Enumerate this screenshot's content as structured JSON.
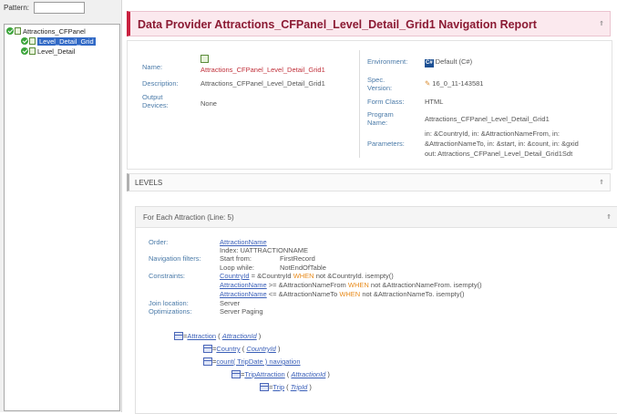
{
  "sidebar": {
    "pattern_label": "Pattern:",
    "pattern_value": "",
    "tree": [
      {
        "label": "Attractions_CFPanel",
        "selected": false
      },
      {
        "label": "Level_Detail_Grid",
        "selected": true
      },
      {
        "label": "Level_Detail",
        "selected": false
      }
    ]
  },
  "header": {
    "title": "Data Provider Attractions_CFPanel_Level_Detail_Grid1 Navigation Report",
    "collapse_icon": "double-up-chevron"
  },
  "info": {
    "name_label": "Name:",
    "name_value": "Attractions_CFPanel_Level_Detail_Grid1",
    "description_label": "Description:",
    "description_value": "Attractions_CFPanel_Level_Detail_Grid1",
    "output_label": "Output Devices:",
    "output_value": "None",
    "environment_label": "Environment:",
    "environment_badge": "C#",
    "environment_value": "Default (C#)",
    "spec_label": "Spec. Version:",
    "spec_value": "16_0_11-143581",
    "formclass_label": "Form Class:",
    "formclass_value": "HTML",
    "program_label": "Program Name:",
    "program_value": "Attractions_CFPanel_Level_Detail_Grid1",
    "parameters_label": "Parameters:",
    "parameters_line1": "in: &CountryId, in: &AttractionNameFrom, in:",
    "parameters_line2": "&AttractionNameTo, in: &start, in: &count, in: &gxid",
    "parameters_line3": "out: Attractions_CFPanel_Level_Detail_Grid1Sdt"
  },
  "levels": {
    "title": "LEVELS",
    "foreach_title": "For Each Attraction (Line: 5)",
    "order_label": "Order:",
    "order_attr": "AttractionName",
    "order_index": "Index: UATTRACTIONNAME",
    "navfilters_label": "Navigation filters:",
    "start_from": "Start from:",
    "start_from_value": "FirstRecord",
    "loop_while": "Loop while:",
    "loop_while_value": "NotEndOfTable",
    "constraints_label": "Constraints:",
    "c1_attr": "CountryId",
    "c1_mid": " = &CountryId ",
    "c1_rest": " not &CountryId. isempty()",
    "c2_attr": "AttractionName",
    "c2_mid": " >= &AttractionNameFrom ",
    "c2_rest": " not &AttractionNameFrom. isempty()",
    "c3_attr": "AttractionName",
    "c3_mid": " <= &AttractionNameTo ",
    "c3_rest": " not &AttractionNameTo. isempty()",
    "when_kw": "WHEN",
    "join_label": "Join location:",
    "join_value": "Server",
    "opt_label": "Optimizations:",
    "opt_value": "Server Paging"
  },
  "navigation": [
    {
      "prefix": "=",
      "name": "Attraction",
      "key": "AttractionId"
    },
    {
      "prefix": "=",
      "name": "Country",
      "key": "CountryId"
    },
    {
      "prefix": "=",
      "name": "count( TripDate ) navigation",
      "key": ""
    },
    {
      "prefix": "=",
      "name": "TripAttraction",
      "key": "AttractionId"
    },
    {
      "prefix": "=",
      "name": "Trip",
      "key": "TripId"
    }
  ],
  "colors": {
    "header_accent": "#c9213f",
    "header_bg": "#fbe9ee",
    "label_blue": "#4a7aa8",
    "link_blue": "#3a5fb8",
    "keyword_orange": "#e88a1a",
    "name_red": "#c0303a"
  }
}
